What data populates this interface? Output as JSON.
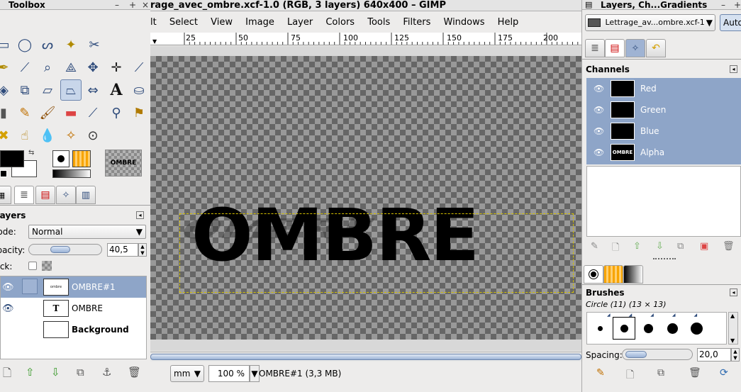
{
  "toolbox": {
    "title": "Toolbox",
    "tools": [
      "rect-select",
      "ellipse-select",
      "free-select",
      "fuzzy-select",
      "scissors",
      "paths",
      "color-picker",
      "zoom",
      "measure",
      "move",
      "align",
      "crop",
      "rotate",
      "scale",
      "shear",
      "perspective",
      "flip",
      "text",
      "bucket-fill",
      "blend",
      "pencil",
      "paintbrush",
      "eraser",
      "airbrush",
      "ink",
      "clone",
      "heal",
      "smudge",
      "dodge-burn",
      "dodge",
      "convolve"
    ],
    "pattern_label": "OMBRE"
  },
  "layers": {
    "title": "Layers",
    "mode_label": "Mode:",
    "mode_value": "Normal",
    "opacity_label": "Opacity:",
    "opacity_value": "40,5",
    "lock_label": "Lock:",
    "items": [
      {
        "name": "OMBRE#1",
        "selected": true
      },
      {
        "name": "OMBRE",
        "selected": false
      },
      {
        "name": "Background",
        "selected": false
      }
    ]
  },
  "image_window": {
    "title": "rage_avec_ombre.xcf-1.0 (RGB, 3 layers) 640x400 – GIMP",
    "menu": [
      "lt",
      "Select",
      "View",
      "Image",
      "Layer",
      "Colors",
      "Tools",
      "Filters",
      "Windows",
      "Help"
    ],
    "ruler_ticks": [
      "25",
      "50",
      "75",
      "100",
      "125",
      "150",
      "175",
      "200"
    ],
    "canvas_text": "OMBRE",
    "unit": "mm",
    "zoom": "100 %",
    "status": "OMBRE#1 (3,3 MB)"
  },
  "dock": {
    "title": "Layers, Ch...Gradients",
    "image_selector": "Lettrage_av...ombre.xcf-1",
    "auto_label": "Auto",
    "channels_title": "Channels",
    "channels": [
      "Red",
      "Green",
      "Blue",
      "Alpha"
    ],
    "alpha_thumb_text": "OMBRE",
    "brushes_title": "Brushes",
    "brush_name": "Circle (11) (13 × 13)",
    "spacing_label": "Spacing:",
    "spacing_value": "20,0"
  },
  "colors": {
    "accent": "#8ea5c8",
    "selected_row": "#8ea5c8",
    "canvas_bg": "#7a7a7a"
  }
}
